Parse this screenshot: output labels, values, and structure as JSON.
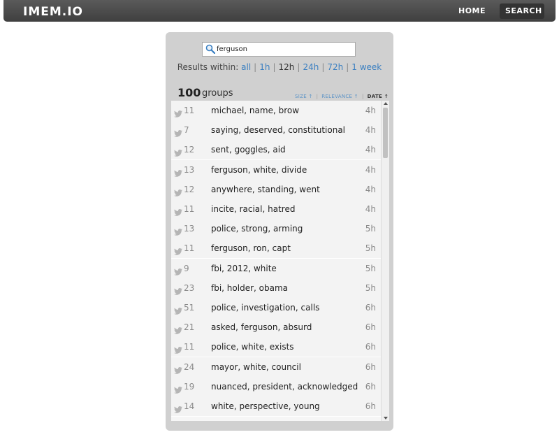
{
  "nav": {
    "logo": "IMEM.IO",
    "home": "HOME",
    "search": "SEARCH"
  },
  "search": {
    "value": "ferguson",
    "placeholder": ""
  },
  "filter": {
    "label": "Results within:",
    "options": [
      "all",
      "1h",
      "12h",
      "24h",
      "72h",
      "1 week"
    ],
    "active": "12h"
  },
  "summary": {
    "count": "100",
    "label": "groups"
  },
  "sort": {
    "size": "SIZE ↑",
    "relevance": "RELEVANCE ↑",
    "date": "DATE ↑"
  },
  "groups": [
    {
      "count": "11",
      "keywords": "michael, name, brow",
      "age": "4h"
    },
    {
      "count": "7",
      "keywords": "saying, deserved, constitutional",
      "age": "4h"
    },
    {
      "count": "12",
      "keywords": "sent, goggles, aid",
      "age": "4h"
    },
    {
      "count": "13",
      "keywords": "ferguson, white, divide",
      "age": "4h"
    },
    {
      "count": "12",
      "keywords": "anywhere, standing, went",
      "age": "4h"
    },
    {
      "count": "11",
      "keywords": "incite, racial, hatred",
      "age": "4h"
    },
    {
      "count": "13",
      "keywords": "police, strong, arming",
      "age": "5h"
    },
    {
      "count": "11",
      "keywords": "ferguson, ron, capt",
      "age": "5h"
    },
    {
      "count": "9",
      "keywords": "fbi, 2012, white",
      "age": "5h"
    },
    {
      "count": "23",
      "keywords": "fbi, holder, obama",
      "age": "5h"
    },
    {
      "count": "51",
      "keywords": "police, investigation, calls",
      "age": "6h"
    },
    {
      "count": "21",
      "keywords": "asked, ferguson, absurd",
      "age": "6h"
    },
    {
      "count": "11",
      "keywords": "police, white, exists",
      "age": "6h"
    },
    {
      "count": "24",
      "keywords": "mayor, white, council",
      "age": "6h"
    },
    {
      "count": "19",
      "keywords": "nuanced, president, acknowledged",
      "age": "6h"
    },
    {
      "count": "14",
      "keywords": "white, perspective, young",
      "age": "6h"
    }
  ],
  "colors": {
    "accent": "#3a7fc1",
    "panel": "#d0d0d0",
    "navbar": "#4a4a4a"
  }
}
